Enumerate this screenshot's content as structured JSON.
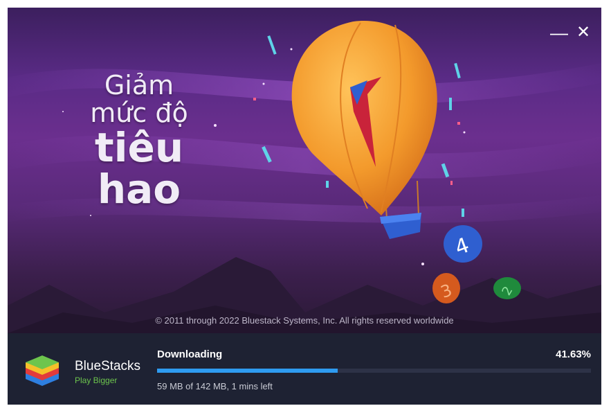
{
  "window": {
    "minimize_glyph": "—",
    "close_glyph": "✕"
  },
  "banner": {
    "headline_line1": "Giảm",
    "headline_line2": "mức độ",
    "headline_line3": "tiêu",
    "headline_line4": "hao",
    "copyright": "© 2011 through 2022 Bluestack Systems, Inc. All rights reserved worldwide"
  },
  "brand": {
    "name": "BlueStacks",
    "tagline": "Play Bigger"
  },
  "download": {
    "status": "Downloading",
    "percent_text": "41.63%",
    "progress": 0.4163,
    "detail": "59 MB of 142 MB, 1 mins left"
  },
  "colors": {
    "accent": "#2e9bf0",
    "tagline": "#6dc54d",
    "balloon": "#f39a2c"
  },
  "icons": [
    "minimize-icon",
    "close-icon",
    "bluestacks-logo-icon"
  ]
}
